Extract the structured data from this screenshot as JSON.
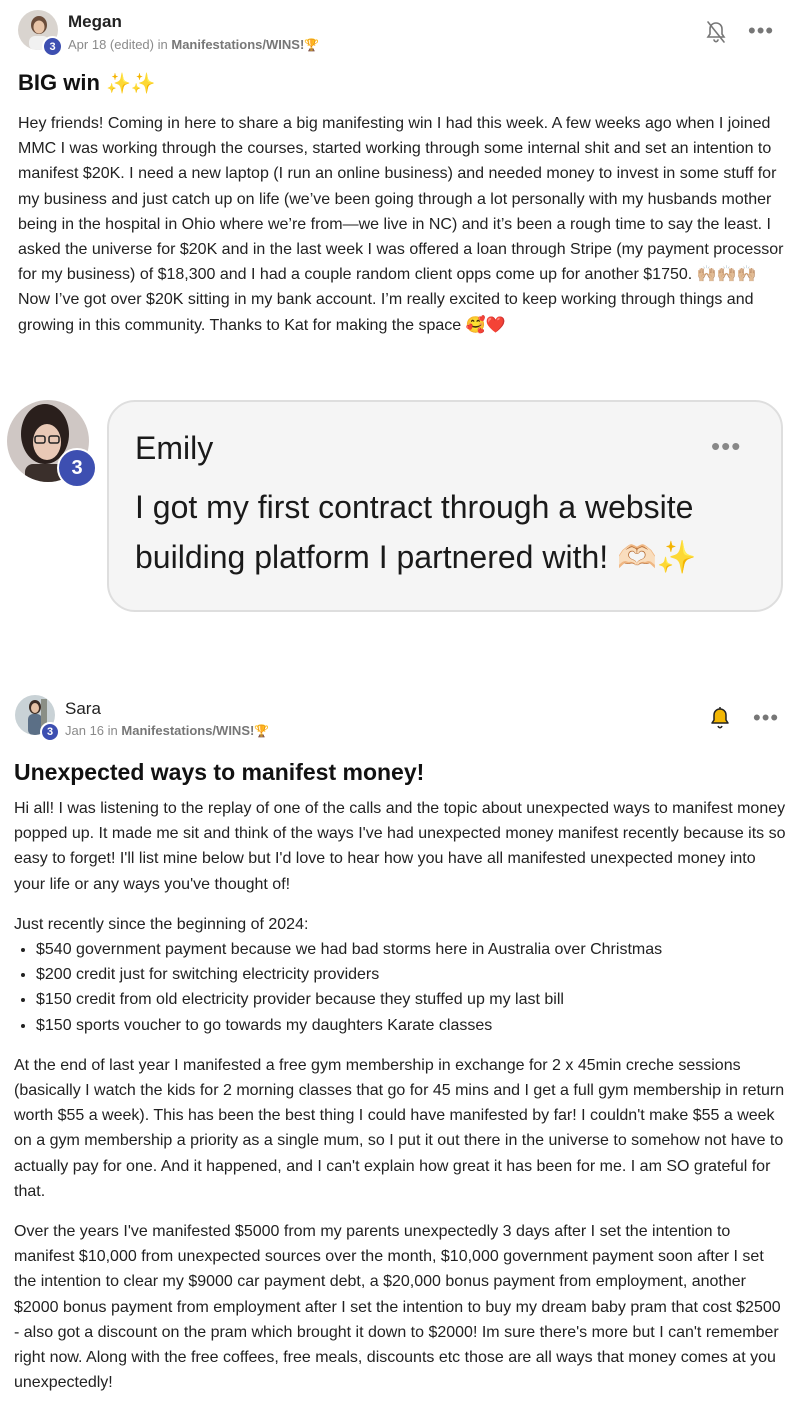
{
  "post1": {
    "author": "Megan",
    "level": "3",
    "date": "Apr 18 (edited)",
    "in_word": "in",
    "category": "Manifestations/WINS!",
    "category_emoji": "🏆",
    "title": "BIG win",
    "title_emoji": "✨✨",
    "body": "Hey friends! Coming in here to share a big manifesting win I had this week. A few weeks ago when I joined MMC I was working through the courses, started working through some internal shit and set an intention to manifest $20K. I need a new laptop (I run an online business) and needed money to invest in some stuff for my business and just catch up on life (we’ve been going through a lot personally with my husbands mother being in the hospital in Ohio where we’re from—we live in NC) and it’s been a rough time to say the least. I asked the universe for $20K and in the last week I was offered a loan through Stripe (my payment processor for my business) of $18,300 and I had a couple random client opps come up for another $1750. 🙌🏼🙌🏼🙌🏼 Now I’ve got over $20K sitting in my bank account. I’m really excited to keep working through things and growing in this community. Thanks to Kat for making the space 🥰❤️"
  },
  "comment": {
    "author": "Emily",
    "level": "3",
    "text": "I got my first contract through a website building platform I partnered with! 🫶🏻✨"
  },
  "post2": {
    "author": "Sara",
    "level": "3",
    "date": "Jan 16",
    "in_word": "in",
    "category": "Manifestations/WINS!",
    "category_emoji": "🏆",
    "title": "Unexpected ways to manifest money!",
    "para1": "Hi all! I was listening to the replay of one of the calls and the topic about unexpected ways to manifest money popped up. It made me sit and think of the ways I've had unexpected money manifest recently because its so easy to forget! I'll list mine below but I'd love to hear how you have all manifested unexpected money into your life or any ways you've thought of!",
    "list_intro": "Just recently since the beginning of 2024:",
    "list": [
      "$540 government payment because we had bad storms here in Australia over Christmas",
      "$200 credit just for switching electricity providers",
      "$150 credit from old electricity provider because they stuffed up my last bill",
      "$150 sports voucher to go towards my daughters Karate classes"
    ],
    "para2": "At the end of last year I manifested a free gym membership in exchange for 2 x 45min creche sessions (basically I watch the kids for 2 morning classes that go for 45 mins and I get a full gym membership in return worth $55 a week). This has been the best thing I could have manifested by far! I couldn't make $55 a week on a gym membership a priority as a single mum, so I put it out there in the universe to somehow not have to actually pay for one. And it happened, and I can't explain how great it has been for me. I am SO grateful for that.",
    "para3": "Over the years I've manifested $5000 from my parents unexpectedly 3 days after I set the intention to manifest $10,000 from unexpected sources over the month, $10,000 government payment soon after I set the intention to clear my $9000 car payment debt, a $20,000 bonus payment from employment, another $2000 bonus payment from employment after I set the intention to buy my dream baby pram that cost $2500 - also got a discount on the pram which brought it down to $2000! Im sure there's more but I can't remember right now. Along with the free coffees, free meals, discounts etc those are all ways that money comes at you unexpectedly!"
  },
  "icons": {
    "bell_muted": "bell-off-icon",
    "bell_active": "bell-icon",
    "more": "more-options-icon"
  },
  "colors": {
    "level_badge": "#3d4fb1",
    "bell_active": "#f2b705"
  }
}
